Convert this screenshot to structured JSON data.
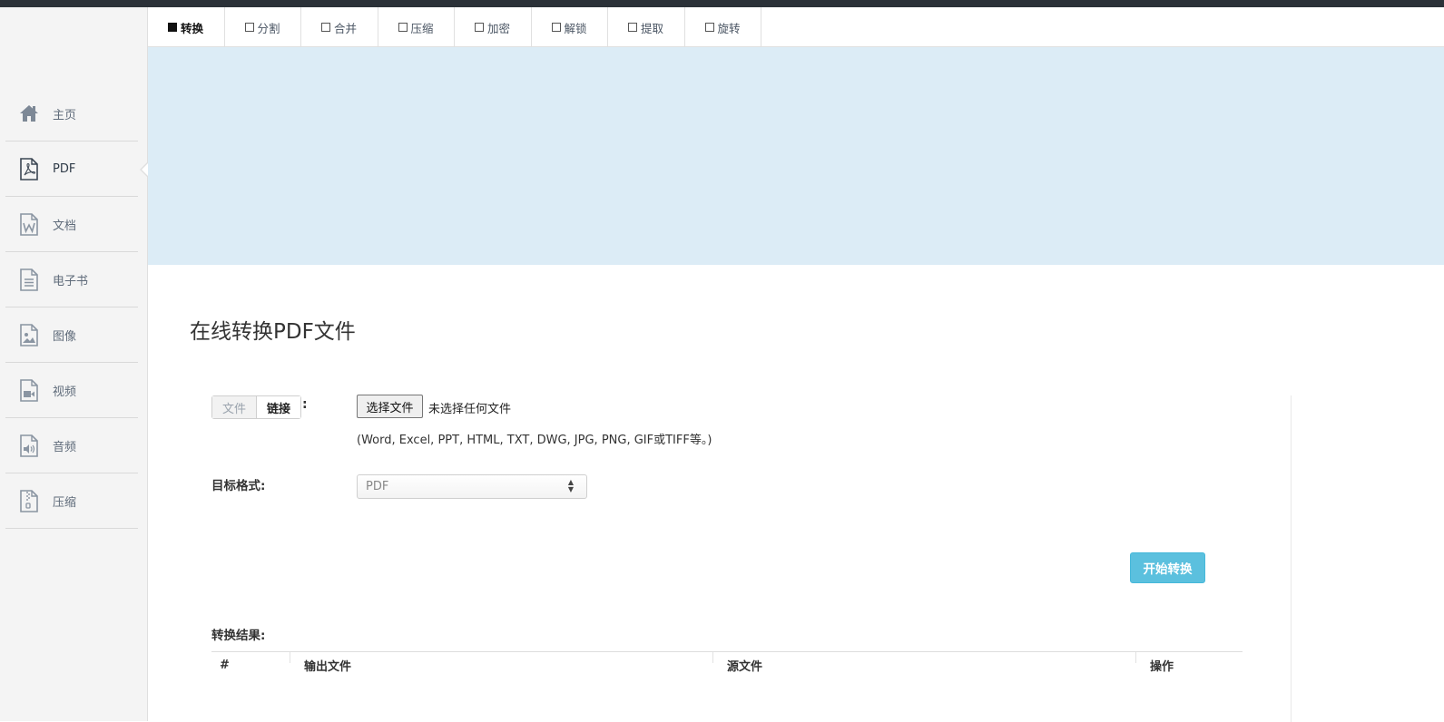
{
  "sidebar": {
    "items": [
      {
        "label": "主页",
        "icon": "home-icon"
      },
      {
        "label": "PDF",
        "icon": "pdf-file-icon",
        "active": true
      },
      {
        "label": "文档",
        "icon": "word-document-icon"
      },
      {
        "label": "电子书",
        "icon": "ebook-icon"
      },
      {
        "label": "图像",
        "icon": "image-file-icon"
      },
      {
        "label": "视频",
        "icon": "video-file-icon"
      },
      {
        "label": "音频",
        "icon": "audio-file-icon"
      },
      {
        "label": "压缩",
        "icon": "archive-file-icon"
      }
    ]
  },
  "tabs": [
    {
      "label": "转换",
      "active": true
    },
    {
      "label": "分割"
    },
    {
      "label": "合并"
    },
    {
      "label": "压缩"
    },
    {
      "label": "加密"
    },
    {
      "label": "解锁"
    },
    {
      "label": "提取"
    },
    {
      "label": "旋转"
    }
  ],
  "main": {
    "title": "在线转换PDF文件",
    "source_toggle": {
      "file_label": "文件",
      "link_label": "链接",
      "colon": ":"
    },
    "file_input": {
      "button_label": "选择文件",
      "status": "未选择任何文件"
    },
    "supported_formats_hint": "(Word, Excel, PPT, HTML, TXT, DWG, JPG, PNG, GIF或TIFF等。)",
    "target_format": {
      "label": "目标格式:",
      "selected": "PDF"
    },
    "start_button": "开始转换",
    "results": {
      "label": "转换结果:",
      "columns": [
        "#",
        "输出文件",
        "源文件",
        "操作"
      ]
    }
  },
  "colors": {
    "banner": "#dcecf6",
    "accent_button": "#5bc0de",
    "sidebar_bg": "#f4f4f4",
    "topbar": "#2b3138"
  }
}
